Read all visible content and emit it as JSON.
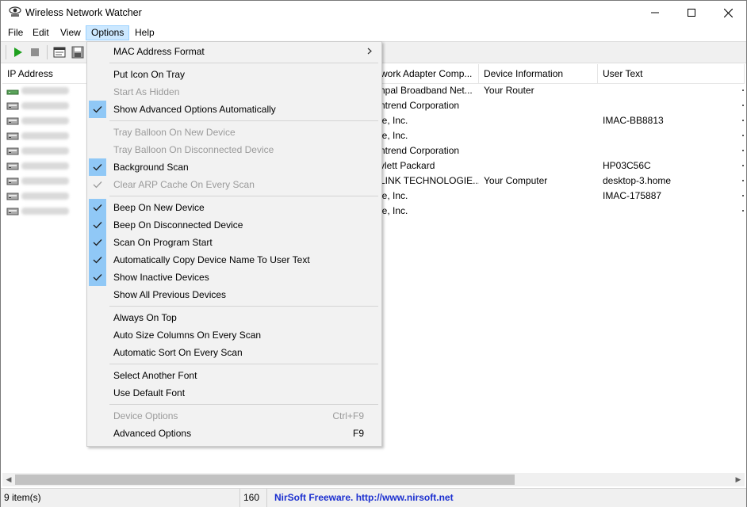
{
  "window": {
    "title": "Wireless Network Watcher",
    "controls": [
      "minimize-icon",
      "maximize-icon",
      "close-icon"
    ]
  },
  "menubar": {
    "items": [
      {
        "label": "File"
      },
      {
        "label": "Edit"
      },
      {
        "label": "View"
      },
      {
        "label": "Options"
      },
      {
        "label": "Help"
      }
    ],
    "active": "Options"
  },
  "toolbar": {
    "buttons": [
      "play-icon",
      "stop-icon",
      "html-report-icon",
      "save-icon"
    ]
  },
  "list": {
    "columns": [
      "IP Address",
      "work Adapter Comp...",
      "Device Information",
      "User Text"
    ],
    "rows": [
      {
        "icon": "router-device-icon",
        "adapter": "npal Broadband Net...",
        "info": "Your Router",
        "user": ""
      },
      {
        "icon": "network-device-icon",
        "adapter": "ntrend Corporation",
        "info": "",
        "user": ""
      },
      {
        "icon": "network-device-icon",
        "adapter": "le, Inc.",
        "info": "",
        "user": "IMAC-BB8813"
      },
      {
        "icon": "network-device-icon",
        "adapter": "le, Inc.",
        "info": "",
        "user": ""
      },
      {
        "icon": "network-device-icon",
        "adapter": "ntrend Corporation",
        "info": "",
        "user": ""
      },
      {
        "icon": "network-device-icon",
        "adapter": "vlett Packard",
        "info": "",
        "user": "HP03C56C"
      },
      {
        "icon": "network-device-icon",
        "adapter": "LINK TECHNOLOGIE...",
        "info": "Your Computer",
        "user": "desktop-3.home"
      },
      {
        "icon": "network-device-icon",
        "adapter": "le, Inc.",
        "info": "",
        "user": "IMAC-175887"
      },
      {
        "icon": "network-device-icon",
        "adapter": "le, Inc.",
        "info": "",
        "user": ""
      }
    ]
  },
  "options_menu": {
    "mac_format": {
      "label": "MAC Address Format"
    },
    "put_icon_on_tray": {
      "label": "Put Icon On Tray",
      "checked": false,
      "enabled": true
    },
    "start_as_hidden": {
      "label": "Start As Hidden",
      "checked": false,
      "enabled": false
    },
    "show_advanced_auto": {
      "label": "Show Advanced Options Automatically",
      "checked": true,
      "enabled": true
    },
    "tray_balloon_new": {
      "label": "Tray Balloon On New Device",
      "checked": false,
      "enabled": false
    },
    "tray_balloon_disconnected": {
      "label": "Tray Balloon On Disconnected Device",
      "checked": false,
      "enabled": false
    },
    "background_scan": {
      "label": "Background Scan",
      "checked": true,
      "enabled": true
    },
    "clear_arp_cache": {
      "label": "Clear ARP Cache On Every Scan",
      "checked": true,
      "enabled": false
    },
    "beep_new": {
      "label": "Beep On New Device",
      "checked": true,
      "enabled": true
    },
    "beep_disconnected": {
      "label": "Beep On Disconnected Device",
      "checked": true,
      "enabled": true
    },
    "scan_on_start": {
      "label": "Scan On Program Start",
      "checked": true,
      "enabled": true
    },
    "auto_copy_name": {
      "label": "Automatically Copy Device Name To User Text",
      "checked": true,
      "enabled": true
    },
    "show_inactive": {
      "label": "Show Inactive Devices",
      "checked": true,
      "enabled": true
    },
    "show_all_previous": {
      "label": "Show All Previous Devices",
      "checked": false,
      "enabled": true
    },
    "always_on_top": {
      "label": "Always On Top",
      "checked": false,
      "enabled": true
    },
    "auto_size_columns": {
      "label": "Auto Size Columns On Every Scan",
      "checked": false,
      "enabled": true
    },
    "auto_sort": {
      "label": "Automatic Sort On Every Scan",
      "checked": false,
      "enabled": true
    },
    "select_font": {
      "label": "Select Another Font",
      "enabled": true
    },
    "default_font": {
      "label": "Use Default Font",
      "enabled": true
    },
    "device_options": {
      "label": "Device Options",
      "shortcut": "Ctrl+F9",
      "enabled": false
    },
    "advanced_options": {
      "label": "Advanced Options",
      "shortcut": "F9",
      "enabled": true
    }
  },
  "statusbar": {
    "items_count": "9 item(s)",
    "scan_value": "160",
    "link_text": "NirSoft Freeware.  http://www.nirsoft.net"
  },
  "colors": {
    "menu_highlight": "#cce8ff",
    "check_background": "#90c8f6",
    "status_link": "#1b2fd0",
    "play_green": "#1ea01e"
  }
}
